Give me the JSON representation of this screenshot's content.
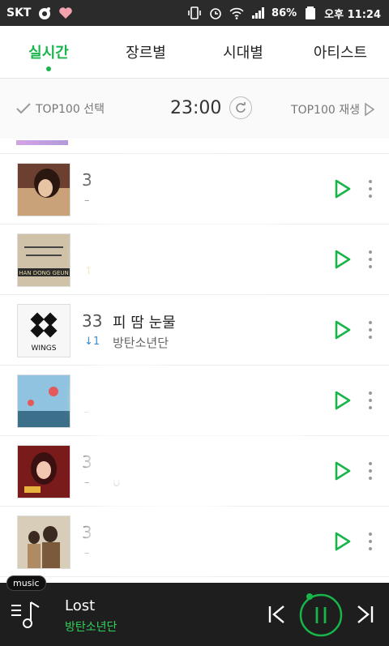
{
  "status": {
    "carrier": "SKT",
    "battery": "86%",
    "time": "오후 11:24",
    "icons": [
      "circle-o-icon",
      "heart-icon",
      "vibrate-icon",
      "alarm-icon",
      "wifi-icon",
      "signal-icon",
      "battery-icon"
    ]
  },
  "tabs": [
    {
      "label": "실시간",
      "active": true
    },
    {
      "label": "장르별",
      "active": false
    },
    {
      "label": "시대별",
      "active": false
    },
    {
      "label": "아티스트",
      "active": false
    }
  ],
  "toolbar": {
    "select_label": "TOP100 선택",
    "time": "23:00",
    "play_label": "TOP100 재생"
  },
  "rows": [
    {
      "rank": "3",
      "change": "–",
      "change_dir": "same",
      "title": "",
      "artist": "",
      "cover": "portrait"
    },
    {
      "rank": "",
      "change": "↑",
      "change_dir": "up",
      "title": "",
      "artist": "",
      "cover": "han-dong-geun",
      "cover_text": "HAN DONG GEUN"
    },
    {
      "rank": "33",
      "change": "↓1",
      "change_dir": "down",
      "title": "피 땀 눈물",
      "artist": "방탄소년단",
      "cover": "wings",
      "cover_text": "WINGS"
    },
    {
      "rank": "",
      "change": "–",
      "change_dir": "same",
      "title": "",
      "artist": "",
      "cover": "sky"
    },
    {
      "rank": "3",
      "change": "–",
      "change_dir": "same",
      "title": "",
      "artist": "0",
      "cover": "red"
    },
    {
      "rank": "3",
      "change": "–",
      "change_dir": "same",
      "title": "",
      "artist": "",
      "cover": "couple"
    }
  ],
  "player": {
    "badge": "music",
    "title": "Lost",
    "artist": "방탄소년단"
  },
  "colors": {
    "accent": "#18b54a",
    "player_bg": "#1e1e1e",
    "statusbar_bg": "#2b2b2b"
  }
}
